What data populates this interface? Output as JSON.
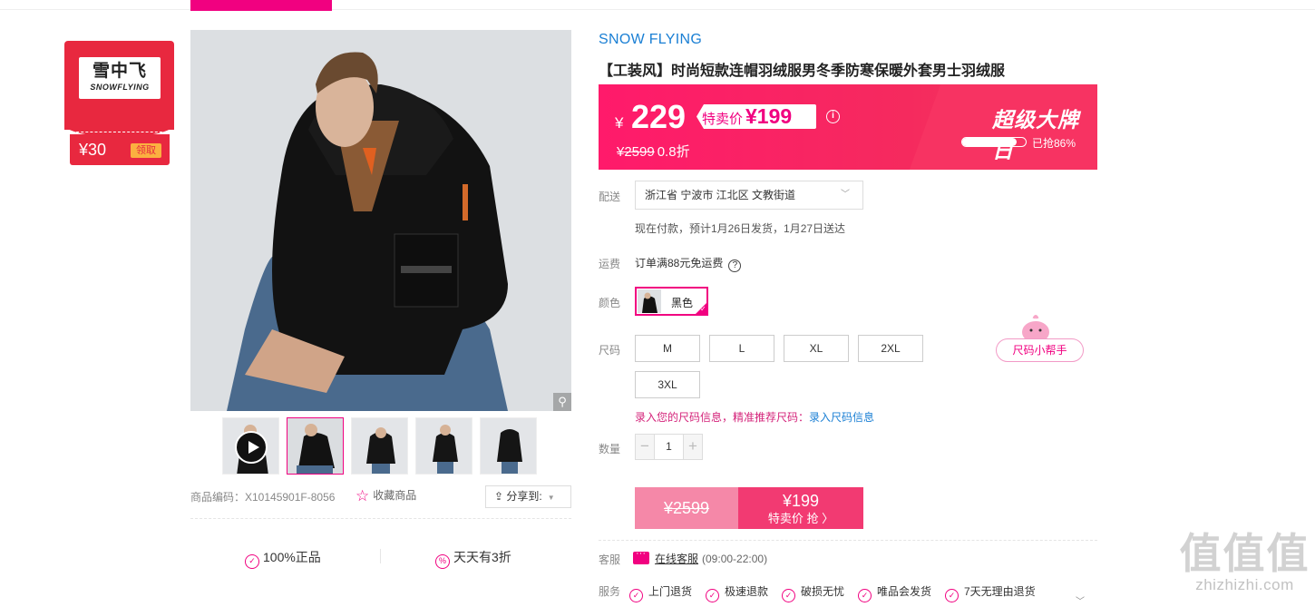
{
  "brand_coupon": {
    "logo_cn": "雪中飞",
    "logo_en": "SNOWFLYING",
    "amount": "¥30",
    "claim_label": "领取"
  },
  "gallery": {
    "product_code_label": "商品编码：X10145901F-8056",
    "favorite_label": "收藏商品",
    "share_label": "分享到:",
    "guarantees": [
      "100%正品",
      "天天有3折"
    ]
  },
  "product": {
    "brand": "SNOW FLYING",
    "title": "【工装风】时尚短款连帽羽绒服男冬季防寒保暖外套男士羽绒服"
  },
  "price": {
    "currency": "¥",
    "current": "229",
    "special_label": "特卖价",
    "special_price": "¥199",
    "original": "¥2599",
    "discount": "0.8折",
    "event": "超级大牌日",
    "sold_percent": 86,
    "sold_label": "已抢86%"
  },
  "delivery": {
    "label": "配送",
    "address": "浙江省 宁波市 江北区 文教街道",
    "estimate": "现在付款，预计1月26日发货，1月27日送达"
  },
  "shipping": {
    "label": "运费",
    "text": "订单满88元免运费"
  },
  "color": {
    "label": "颜色",
    "selected": "黑色"
  },
  "size": {
    "label": "尺码",
    "options": [
      "M",
      "L",
      "XL",
      "2XL",
      "3XL"
    ],
    "helper": "尺码小帮手",
    "hint_prefix": "录入您的尺码信息，精准推荐尺码：",
    "hint_link": "录入尺码信息"
  },
  "quantity": {
    "label": "数量",
    "value": "1",
    "minus": "−",
    "plus": "+"
  },
  "buy": {
    "original": "¥2599",
    "price": "¥199",
    "action": "特卖价 抢 〉"
  },
  "customer_service": {
    "label": "客服",
    "link": "在线客服",
    "hours": "(09:00-22:00)"
  },
  "services": {
    "label": "服务",
    "items": [
      "上门退货",
      "极速退款",
      "破损无忧",
      "唯品会发货",
      "7天无理由退货"
    ]
  },
  "watermark": {
    "big": "值值值",
    "small": "zhizhizhi.com"
  },
  "colors": {
    "accent": "#f10180",
    "banner": "#ff1a6b",
    "link": "#1a7fd4"
  }
}
